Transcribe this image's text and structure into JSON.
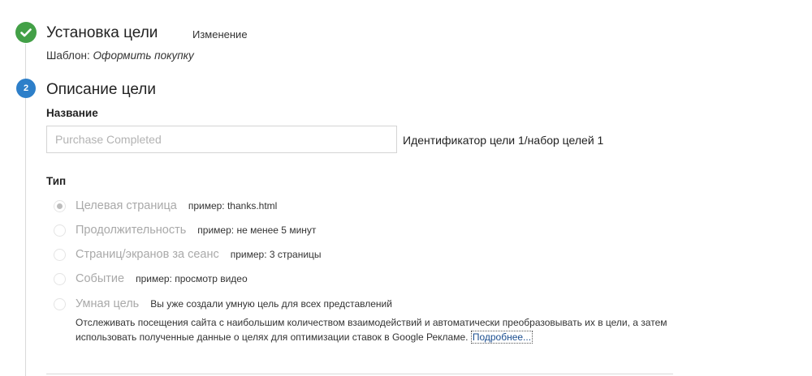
{
  "step1": {
    "number": "1",
    "title": "Установка цели",
    "edit_label": "Изменение",
    "template_prefix": "Шаблон: ",
    "template_value": "Оформить покупку"
  },
  "step2": {
    "number": "2",
    "title": "Описание цели",
    "name_label": "Название",
    "name_placeholder": "Purchase Completed",
    "name_value": "",
    "goal_id": "Идентификатор цели 1/набор целей 1",
    "type_label": "Тип",
    "types": [
      {
        "label": "Целевая страница",
        "example": "пример: thanks.html",
        "selected": true
      },
      {
        "label": "Продолжительность",
        "example": "пример: не менее 5 минут",
        "selected": false
      },
      {
        "label": "Страниц/экранов за сеанс",
        "example": "пример: 3 страницы",
        "selected": false
      },
      {
        "label": "Событие",
        "example": "пример: просмотр видео",
        "selected": false
      },
      {
        "label": "Умная цель",
        "example": "Вы уже создали умную цель для всех представлений",
        "selected": false
      }
    ],
    "smart_description": "Отслеживать посещения сайта с наибольшим количеством взаимодействий и автоматически преобразовывать их в цели, а затем использовать полученные данные о целях для оптимизации ставок в Google Рекламе. ",
    "more_link": "Подробнее..."
  },
  "colors": {
    "check_green": "#43a047",
    "step_blue": "#2d7fc9",
    "disabled_text": "#a9a9a9",
    "link": "#1a4d8f"
  }
}
